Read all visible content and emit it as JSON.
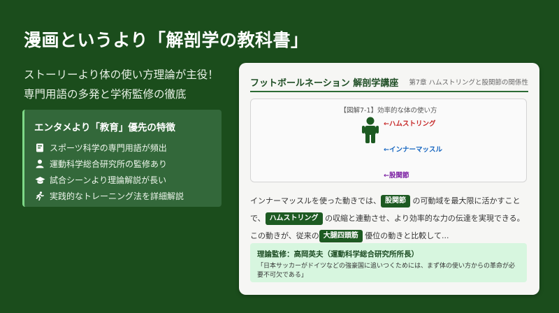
{
  "headline": "漫画というより「解剖学の教科書」",
  "subtitle": {
    "line1": "ストーリーより体の使い方理論が主役！",
    "line2": "専門用語の多発と学術監修の徹底"
  },
  "features": {
    "title": "エンタメより「教育」優先の特徴",
    "items": [
      {
        "icon": "book-icon",
        "label": "スポーツ科学の専門用語が頻出"
      },
      {
        "icon": "user-icon",
        "label": "運動科学総合研究所の監修あり"
      },
      {
        "icon": "graduation-cap-icon",
        "label": "試合シーンより理論解説が長い"
      },
      {
        "icon": "running-icon",
        "label": "実践的なトレーニング法を詳細解説"
      }
    ]
  },
  "card": {
    "title": "フットボールネーション 解剖学講座",
    "chapter": "第7章 ハムストリングと股関節の関係性",
    "figure": {
      "caption": "【図解7-1】効率的な体の使い方",
      "labels": {
        "hamstring": "←ハムストリング",
        "inner_muscle": "←インナーマッスル",
        "hip_joint": "←股関節"
      }
    },
    "body": {
      "t1": "インナーマッスルを使った動きでは、",
      "term1": "股関節",
      "t2": "の可動域を最大限に活かすことで、",
      "term2": "ハムストリング",
      "t3": "の収縮と連動させ、より効率的な力の伝達を実現できる。この動きが、従来の",
      "term3": "大腿四頭筋",
      "t4": "優位の動きと比較して..."
    },
    "supervision": {
      "name": "理論監修：高岡英夫（運動科学総合研究所所長）",
      "quote": "「日本サッカーがドイツなどの強豪国に追いつくためには、まず体の使い方からの革命が必要不可欠である」"
    }
  },
  "colors": {
    "background": "#1b4d1c",
    "accent": "#7ed887",
    "term_badge": "#1d5a22",
    "hamstring": "#c62828",
    "inner_muscle": "#1565c0",
    "hip_joint": "#7b1fa2"
  }
}
